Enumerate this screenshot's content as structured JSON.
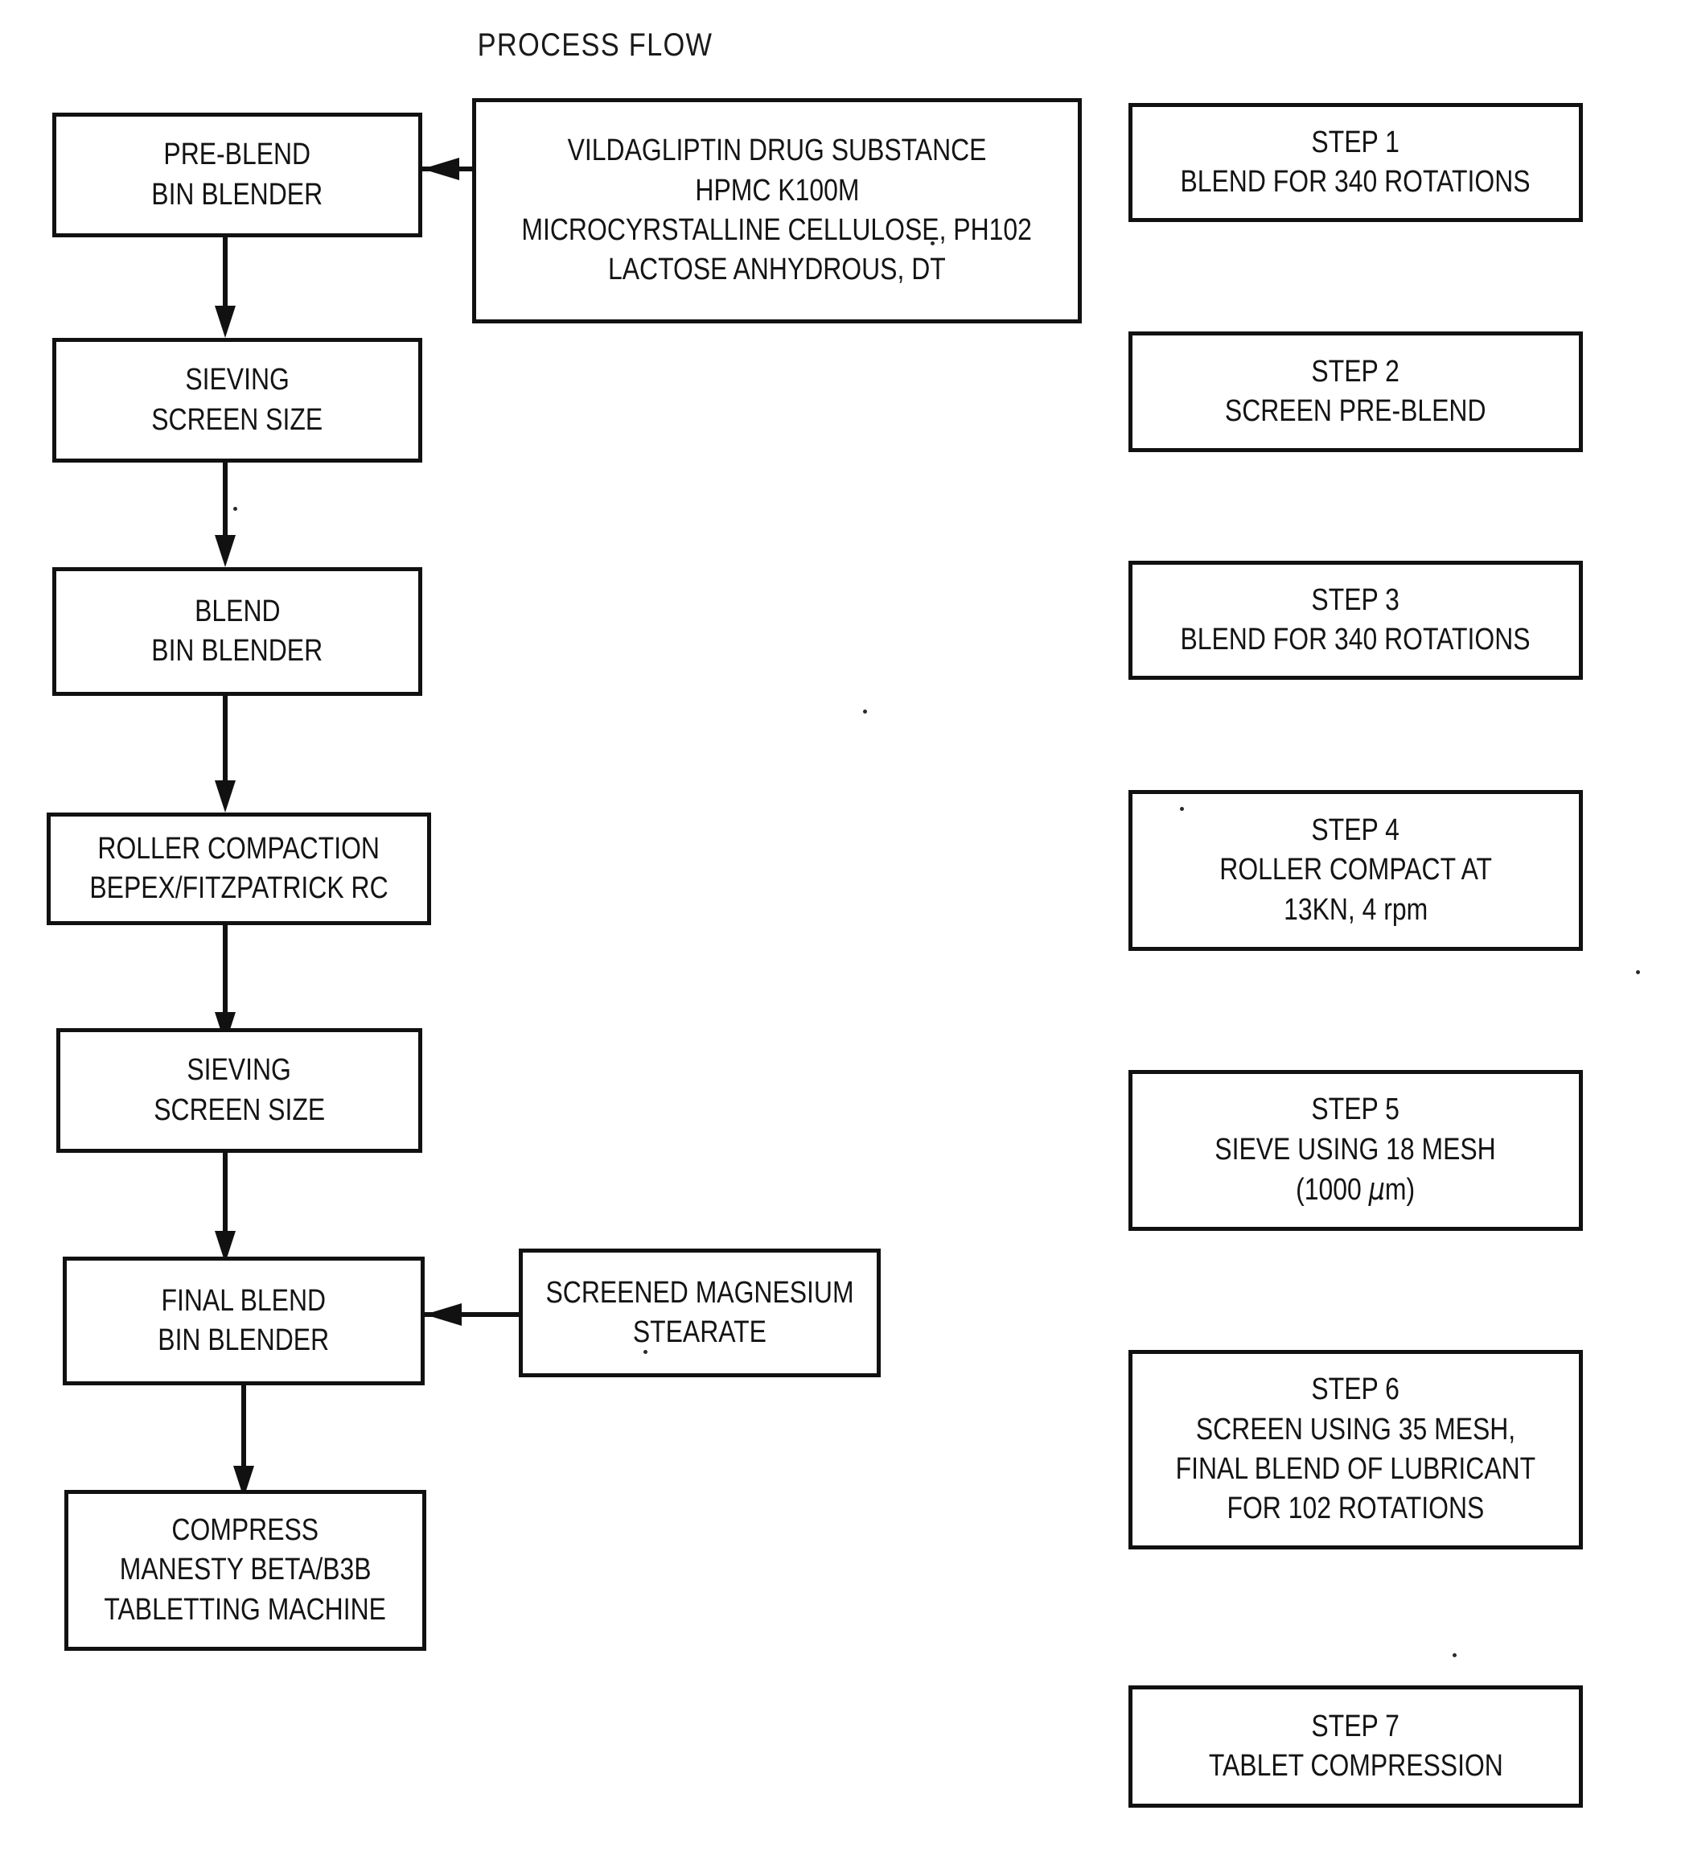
{
  "title": "PROCESS FLOW",
  "process_steps": [
    {
      "id": "pre-blend",
      "lines": [
        "PRE-BLEND",
        "BIN BLENDER"
      ]
    },
    {
      "id": "sieving-1",
      "lines": [
        "SIEVING",
        "SCREEN SIZE"
      ]
    },
    {
      "id": "blend",
      "lines": [
        "BLEND",
        "BIN BLENDER"
      ]
    },
    {
      "id": "roller-compaction",
      "lines": [
        "ROLLER COMPACTION",
        "BEPEX/FITZPATRICK RC"
      ]
    },
    {
      "id": "sieving-2",
      "lines": [
        "SIEVING",
        "SCREEN SIZE"
      ]
    },
    {
      "id": "final-blend",
      "lines": [
        "FINAL BLEND",
        "BIN BLENDER"
      ]
    },
    {
      "id": "compress",
      "lines": [
        "COMPRESS",
        "MANESTY BETA/B3B",
        "TABLETTING MACHINE"
      ]
    }
  ],
  "ingredients": {
    "lines": [
      "VILDAGLIPTIN DRUG SUBSTANCE",
      "HPMC K100M",
      "MICROCYRSTALLINE CELLULOSE, PH102",
      "LACTOSE ANHYDROUS, DT"
    ]
  },
  "additive": {
    "lines": [
      "SCREENED MAGNESIUM",
      "STEARATE"
    ]
  },
  "steps": [
    {
      "number": "STEP 1",
      "lines": [
        "BLEND FOR 340 ROTATIONS"
      ]
    },
    {
      "number": "STEP 2",
      "lines": [
        "SCREEN PRE-BLEND"
      ]
    },
    {
      "number": "STEP 3",
      "lines": [
        "BLEND FOR 340 ROTATIONS"
      ]
    },
    {
      "number": "STEP 4",
      "lines": [
        "ROLLER COMPACT AT",
        "13KN, 4 rpm"
      ]
    },
    {
      "number": "STEP 5",
      "lines": [
        "SIEVE USING 18 MESH",
        "(1000 μm)"
      ]
    },
    {
      "number": "STEP 6",
      "lines": [
        "SCREEN USING 35 MESH,",
        "FINAL BLEND OF LUBRICANT",
        "FOR 102 ROTATIONS"
      ]
    },
    {
      "number": "STEP 7",
      "lines": [
        "TABLET COMPRESSION"
      ]
    }
  ],
  "colors": {
    "ink": "#111111",
    "paper": "#ffffff"
  }
}
